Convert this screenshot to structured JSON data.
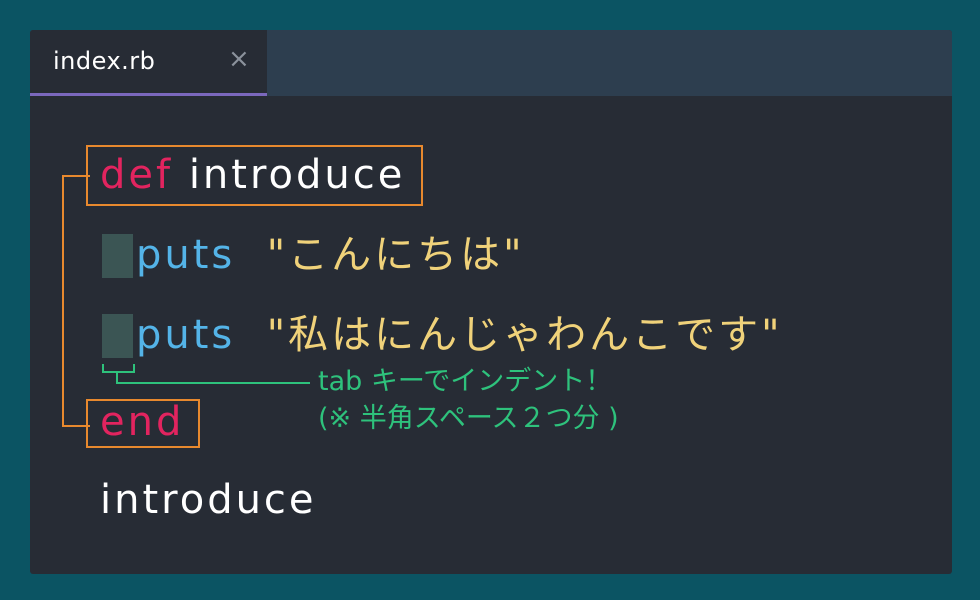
{
  "tab": {
    "filename": "index.rb",
    "close": "×"
  },
  "code": {
    "line1": {
      "keyword": "def",
      "name": "introduce"
    },
    "line2": {
      "method": "puts",
      "string": "\"こんにちは\""
    },
    "line3": {
      "method": "puts",
      "string": "\"私はにんじゃわんこです\""
    },
    "line4": {
      "keyword": "end"
    },
    "line5": {
      "call": "introduce"
    }
  },
  "annotation": {
    "line1": "tab キーでインデント！",
    "line2": "(※ 半角スペース２つ分 )"
  },
  "colors": {
    "background": "#0b5463",
    "editor": "#272c35",
    "tabbar": "#2d3e4f",
    "tab_underline": "#7b68bd",
    "keyword": "#e2245f",
    "method": "#54b4e8",
    "string": "#f0d27a",
    "highlight_box": "#e8892e",
    "note": "#2ec27c"
  }
}
